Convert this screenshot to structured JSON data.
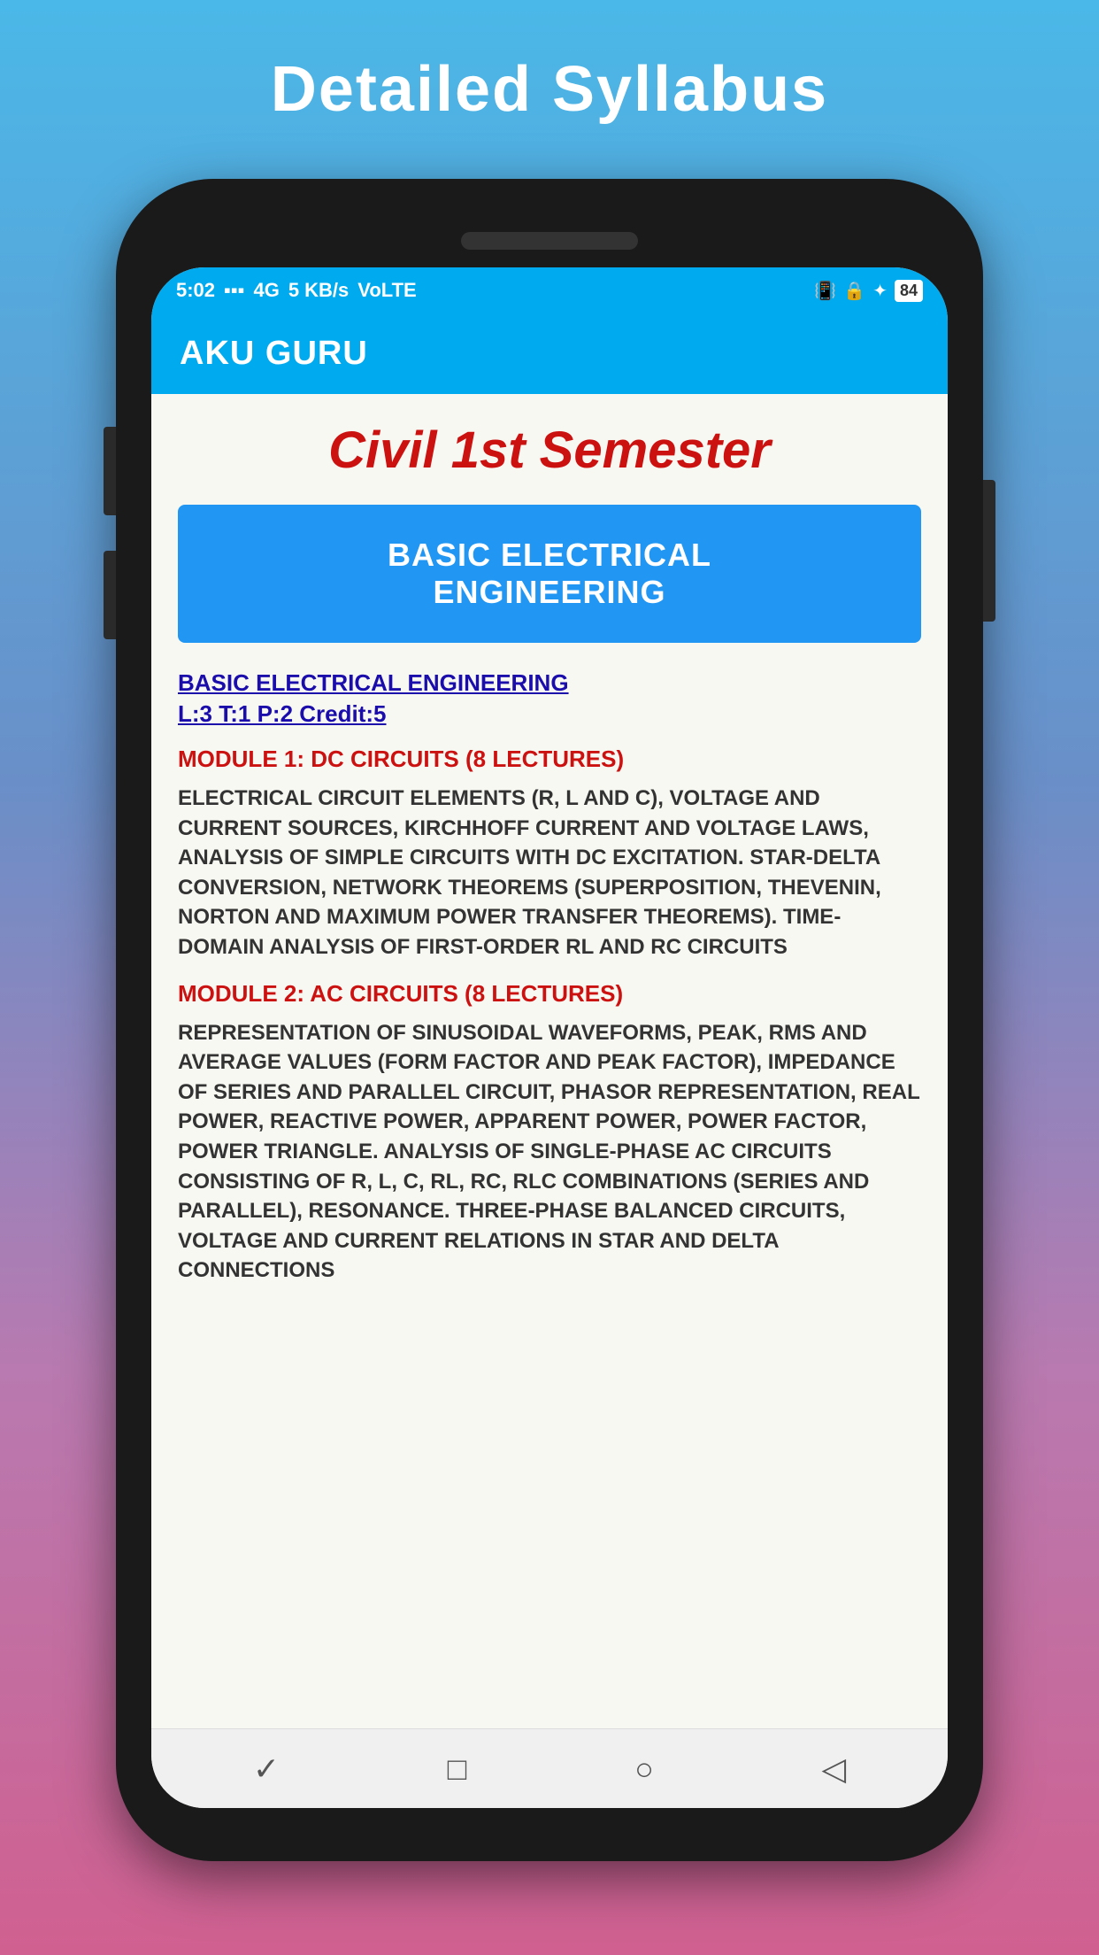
{
  "page": {
    "background_title": "Detailed Syllabus"
  },
  "status_bar": {
    "time": "5:02",
    "signal": "▪▪▪",
    "network": "4G",
    "speed": "5 KB/s",
    "lte": "VoLTE",
    "battery": "84"
  },
  "app_bar": {
    "title": "AKU GURU"
  },
  "screen": {
    "semester_title": "Civil 1st Semester",
    "subject_button_label": "BASIC ELECTRICAL\nENGINEERING",
    "subject_link_line1": "BASIC ELECTRICAL ENGINEERING",
    "subject_link_line2": "L:3 T:1 P:2 Credit:5",
    "module1_header": "MODULE 1: DC CIRCUITS (8 LECTURES)",
    "module1_content": "ELECTRICAL CIRCUIT ELEMENTS (R, L AND C), VOLTAGE AND CURRENT SOURCES, KIRCHHOFF CURRENT AND VOLTAGE LAWS, ANALYSIS OF SIMPLE CIRCUITS WITH DC EXCITATION. STAR-DELTA CONVERSION, NETWORK THEOREMS (SUPERPOSITION, THEVENIN, NORTON AND MAXIMUM POWER TRANSFER THEOREMS). TIME-DOMAIN ANALYSIS OF FIRST-ORDER RL AND RC CIRCUITS",
    "module2_header": "MODULE 2: AC CIRCUITS (8 LECTURES)",
    "module2_content": "REPRESENTATION OF SINUSOIDAL WAVEFORMS, PEAK, RMS AND AVERAGE VALUES (FORM FACTOR AND PEAK FACTOR), IMPEDANCE OF SERIES AND PARALLEL CIRCUIT, PHASOR REPRESENTATION, REAL POWER, REACTIVE POWER, APPARENT POWER, POWER FACTOR, POWER TRIANGLE. ANALYSIS OF SINGLE-PHASE AC CIRCUITS CONSISTING OF R, L, C, RL, RC, RLC COMBINATIONS (SERIES AND PARALLEL), RESONANCE. THREE-PHASE BALANCED CIRCUITS, VOLTAGE AND CURRENT RELATIONS IN STAR AND DELTA CONNECTIONS"
  },
  "bottom_nav": {
    "back_icon": "✓",
    "home_icon": "□",
    "circle_icon": "○",
    "forward_icon": "◁"
  }
}
